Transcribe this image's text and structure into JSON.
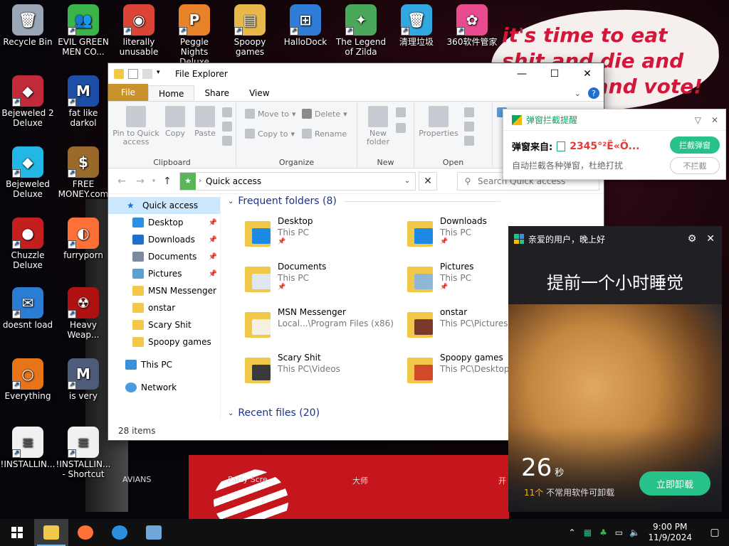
{
  "desktop": {
    "icons": [
      {
        "label": "Recycle Bin",
        "icon": "recycle-bin-icon",
        "color": "#9aa6b5",
        "glyph": "🗑"
      },
      {
        "label": "EVIL GREEN MEN CO...",
        "icon": "msn-icon",
        "color": "#3bb54a",
        "glyph": "👥"
      },
      {
        "label": "literally unusable",
        "icon": "chrome-icon",
        "color": "#db4437",
        "glyph": "◉"
      },
      {
        "label": "Peggle Nights Deluxe",
        "icon": "peggle-icon",
        "color": "#e8832a",
        "glyph": "P"
      },
      {
        "label": "Spoopy games",
        "icon": "folder-icon",
        "color": "#e9b84a",
        "glyph": "▤"
      },
      {
        "label": "HalloDock",
        "icon": "windows-logo-icon",
        "color": "#2f7dd6",
        "glyph": "⊞"
      },
      {
        "label": "The Legend of Zilda",
        "icon": "game-icon",
        "color": "#4aa85b",
        "glyph": "✦"
      },
      {
        "label": "清理垃圾",
        "icon": "trash-clean-icon",
        "color": "#30a8e0",
        "glyph": "🗑"
      },
      {
        "label": "360软件管家",
        "icon": "360-manager-icon",
        "color": "#e94b8f",
        "glyph": "✿"
      },
      {
        "label": "Bejeweled 2 Deluxe",
        "icon": "gem-icon",
        "color": "#c22a3a",
        "glyph": "◆"
      },
      {
        "label": "fat like darkol",
        "icon": "mpl-icon",
        "color": "#1d4fa8",
        "glyph": "M"
      },
      {
        "label": "Bejeweled Deluxe",
        "icon": "diamond-icon",
        "color": "#22b7e6",
        "glyph": "◆"
      },
      {
        "label": "FREE MONEY.com",
        "icon": "money-bag-icon",
        "color": "#9a6a2b",
        "glyph": "$"
      },
      {
        "label": "Chuzzle Deluxe",
        "icon": "chuzzle-icon",
        "color": "#c41e1e",
        "glyph": "●"
      },
      {
        "label": "furryporn",
        "icon": "firefox-icon",
        "color": "#ff7139",
        "glyph": "◐"
      },
      {
        "label": "doesnt load",
        "icon": "thunderbird-icon",
        "color": "#2b7cd3",
        "glyph": "✉"
      },
      {
        "label": "Heavy Weap...",
        "icon": "radiation-icon",
        "color": "#b01212",
        "glyph": "☢"
      },
      {
        "label": "Everything",
        "icon": "everything-search-icon",
        "color": "#e8741a",
        "glyph": "○"
      },
      {
        "label": "is very",
        "icon": "mpl-shield-icon",
        "color": "#4e5d7a",
        "glyph": "M"
      },
      {
        "label": "!INSTALLIN...",
        "icon": "text-file-icon",
        "color": "#f0f0f0",
        "glyph": "≡"
      },
      {
        "label": "!INSTALLIN... - Shortcut",
        "icon": "text-file-shortcut-icon",
        "color": "#f0f0f0",
        "glyph": "≡"
      }
    ],
    "wallpaper_text": "it's time to eat shit and die and go trick and vote!",
    "wallpaper_labels": [
      "AVIANS",
      "Party Scre...",
      "大师",
      "开"
    ]
  },
  "explorer": {
    "title": "File Explorer",
    "tabs": [
      "File",
      "Home",
      "Share",
      "View"
    ],
    "active_tab": "Home",
    "ribbon": {
      "clipboard": {
        "name": "Clipboard",
        "pin": "Pin to Quick access",
        "copy": "Copy",
        "paste": "Paste"
      },
      "organize": {
        "name": "Organize",
        "move_to": "Move to",
        "copy_to": "Copy to",
        "delete": "Delete",
        "rename": "Rename"
      },
      "new": {
        "name": "New",
        "new_folder": "New folder"
      },
      "open": {
        "name": "Open",
        "properties": "Properties"
      }
    },
    "address": {
      "path": "Quick access",
      "search_placeholder": "Search Quick access"
    },
    "nav": {
      "quick_access": "Quick access",
      "pinned": [
        {
          "label": "Desktop",
          "pinned": true,
          "color": "#2d8fe0"
        },
        {
          "label": "Downloads",
          "pinned": true,
          "color": "#1d6fd0"
        },
        {
          "label": "Documents",
          "pinned": true,
          "color": "#7a8aa0"
        },
        {
          "label": "Pictures",
          "pinned": true,
          "color": "#5aa0d0"
        },
        {
          "label": "MSN Messenger",
          "pinned": false,
          "color": "#f2c84b"
        },
        {
          "label": "onstar",
          "pinned": false,
          "color": "#f2c84b"
        },
        {
          "label": "Scary Shit",
          "pinned": false,
          "color": "#f2c84b"
        },
        {
          "label": "Spoopy games",
          "pinned": false,
          "color": "#f2c84b"
        }
      ],
      "this_pc": "This PC",
      "network": "Network"
    },
    "frequent": {
      "header": "Frequent folders (8)",
      "folders": [
        {
          "name": "Desktop",
          "location": "This PC",
          "pinned": true,
          "overlay": "#1e88e5"
        },
        {
          "name": "Downloads",
          "location": "This PC",
          "pinned": true,
          "overlay": "#1e88e5"
        },
        {
          "name": "Documents",
          "location": "This PC",
          "pinned": true,
          "overlay": "#dfe6ee"
        },
        {
          "name": "Pictures",
          "location": "This PC",
          "pinned": true,
          "overlay": "#8fb8d8"
        },
        {
          "name": "MSN Messenger",
          "location": "Local...\\Program Files (x86)",
          "pinned": false,
          "overlay": "#f6f0e0"
        },
        {
          "name": "onstar",
          "location": "This PC\\Pictures",
          "pinned": false,
          "overlay": "#7a3a2a"
        },
        {
          "name": "Scary Shit",
          "location": "This PC\\Videos",
          "pinned": false,
          "overlay": "#3a3a3a"
        },
        {
          "name": "Spoopy games",
          "location": "This PC\\Desktop",
          "pinned": false,
          "overlay": "#d04a2a"
        }
      ]
    },
    "recent_header": "Recent files (20)",
    "status": "28 items"
  },
  "popup_block": {
    "title": "弹窗拦截提醒",
    "source_label": "弹窗来自:",
    "source_value": "2345°²Ë«Ö...",
    "desc": "自动拦截各种弹窗，杜绝打扰",
    "block_btn": "拦截弹窗",
    "no_block_btn": "不拦截"
  },
  "popup_ad": {
    "greeting": "亲爱的用户，晚上好",
    "headline": "提前一个小时睡觉",
    "countdown": "26",
    "countdown_unit": "秒",
    "apps_count": "11个",
    "apps_text": "不常用软件可卸载",
    "uninstall_btn": "立即卸载"
  },
  "taskbar": {
    "time": "9:00 PM",
    "date": "11/9/2024"
  }
}
